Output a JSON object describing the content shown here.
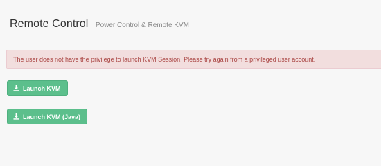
{
  "header": {
    "title": "Remote Control",
    "subtitle": "Power Control & Remote KVM"
  },
  "alert": {
    "message": "The user does not have the privilege to launch KVM Session. Please try again from a privileged user account."
  },
  "buttons": {
    "launch_kvm": {
      "label": "Launch KVM",
      "icon": "download-icon"
    },
    "launch_kvm_java": {
      "label": "Launch KVM (Java)",
      "icon": "download-icon"
    }
  },
  "colors": {
    "background": "#f7f7f7",
    "alert_bg": "#f2dede",
    "alert_text": "#a94442",
    "button_bg": "#5cbf8c"
  }
}
